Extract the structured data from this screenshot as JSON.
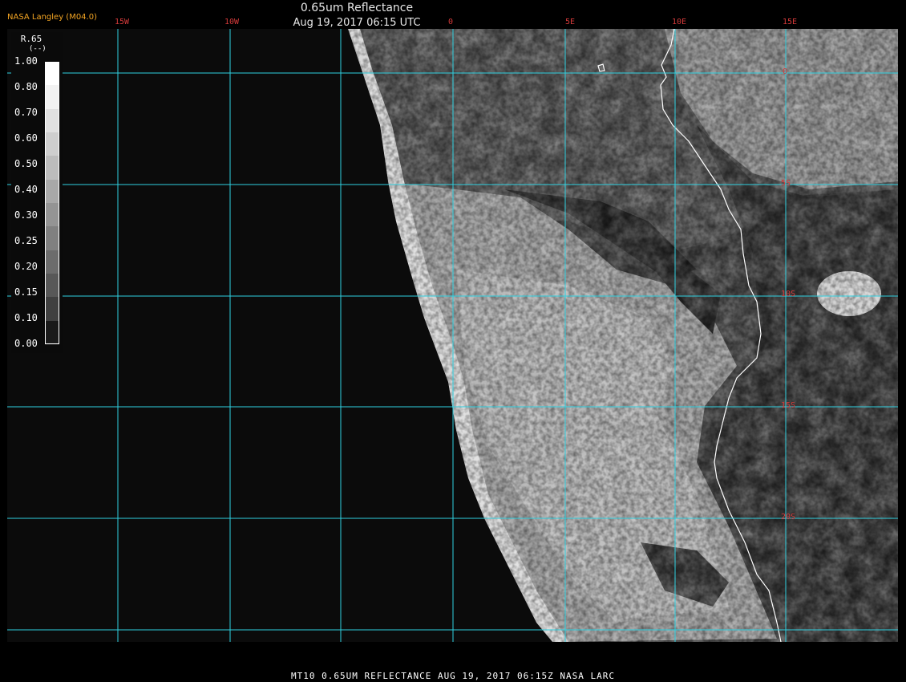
{
  "header": {
    "credit": "NASA Langley (M04.0)",
    "title": "0.65um Reflectance",
    "timestamp": "Aug 19, 2017 06:15 UTC"
  },
  "map": {
    "grid_color": "#2fd0e0",
    "coast_color": "#ffffff",
    "label_color": "#d43a3a",
    "longitude_labels": [
      "15W",
      "10W",
      "0",
      "5E",
      "10E",
      "15E"
    ],
    "latitude_labels": [
      "0",
      "5S",
      "10S",
      "15S",
      "20S"
    ]
  },
  "legend": {
    "title": "R.65",
    "unit": "(--)",
    "ticks": [
      "1.00",
      "0.80",
      "0.70",
      "0.60",
      "0.50",
      "0.40",
      "0.30",
      "0.25",
      "0.20",
      "0.15",
      "0.10",
      "0.00"
    ],
    "shades": [
      "#ffffff",
      "#f2f2f2",
      "#e0e0e0",
      "#cecece",
      "#bcbcbc",
      "#a8a8a8",
      "#949494",
      "#808080",
      "#6c6c6c",
      "#585858",
      "#404040",
      "#1a1a1a"
    ]
  },
  "footer": {
    "caption": "MT10  0.65UM REFLECTANCE   AUG 19, 2017 06:15Z   NASA LARC"
  }
}
